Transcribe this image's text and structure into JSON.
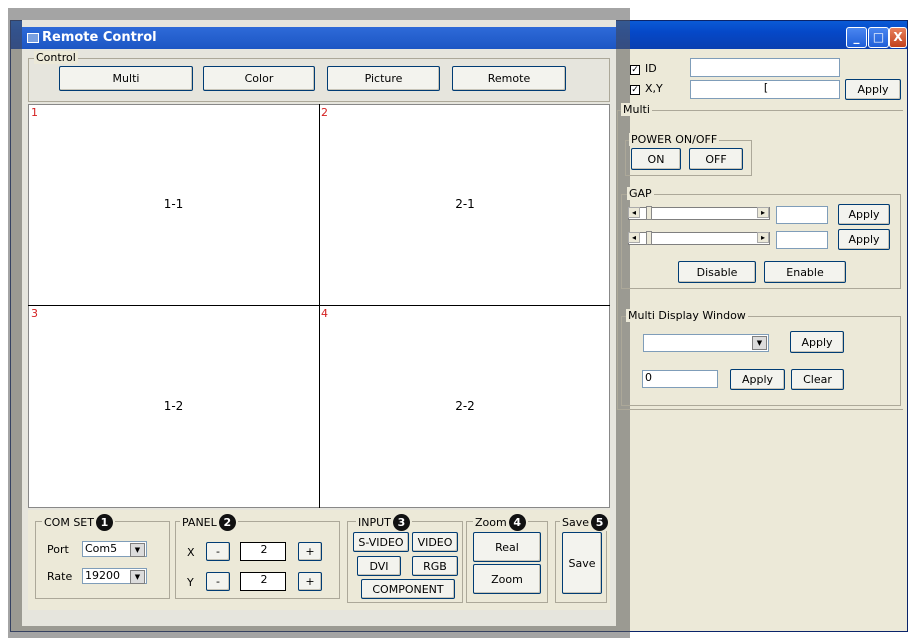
{
  "window": {
    "title": "Remote Control",
    "buttons": {
      "minimize": "_",
      "maximize": "□",
      "close": "X"
    }
  },
  "control": {
    "legend": "Control",
    "tabs": [
      "Multi",
      "Color",
      "Picture",
      "Remote"
    ]
  },
  "grid": [
    {
      "num": "1",
      "label": "1-1"
    },
    {
      "num": "2",
      "label": "2-1"
    },
    {
      "num": "3",
      "label": "1-2"
    },
    {
      "num": "4",
      "label": "2-2"
    }
  ],
  "com_set": {
    "legend": "COM SET",
    "badge": "1",
    "port_label": "Port",
    "port_value": "Com5",
    "rate_label": "Rate",
    "rate_value": "19200"
  },
  "panel": {
    "legend": "PANEL",
    "badge": "2",
    "x_label": "X",
    "x_value": "2",
    "y_label": "Y",
    "y_value": "2",
    "minus": "-",
    "plus": "+"
  },
  "input": {
    "legend": "INPUT",
    "badge": "3",
    "buttons": [
      "S-VIDEO",
      "VIDEO",
      "DVI",
      "RGB",
      "COMPONENT"
    ]
  },
  "zoom": {
    "legend": "Zoom",
    "badge": "4",
    "real": "Real",
    "zoom": "Zoom"
  },
  "save": {
    "legend": "Save",
    "badge": "5",
    "save": "Save"
  },
  "right": {
    "id_label": "ID",
    "xy_label": "X,Y",
    "xy_value": "[",
    "apply": "Apply",
    "multi_legend": "Multi",
    "power_legend": "POWER ON/OFF",
    "on": "ON",
    "off": "OFF",
    "gap_legend": "GAP",
    "disable": "Disable",
    "enable": "Enable",
    "mdw_legend": "Multi Display Window",
    "mdw_value": "0",
    "clear": "Clear"
  }
}
